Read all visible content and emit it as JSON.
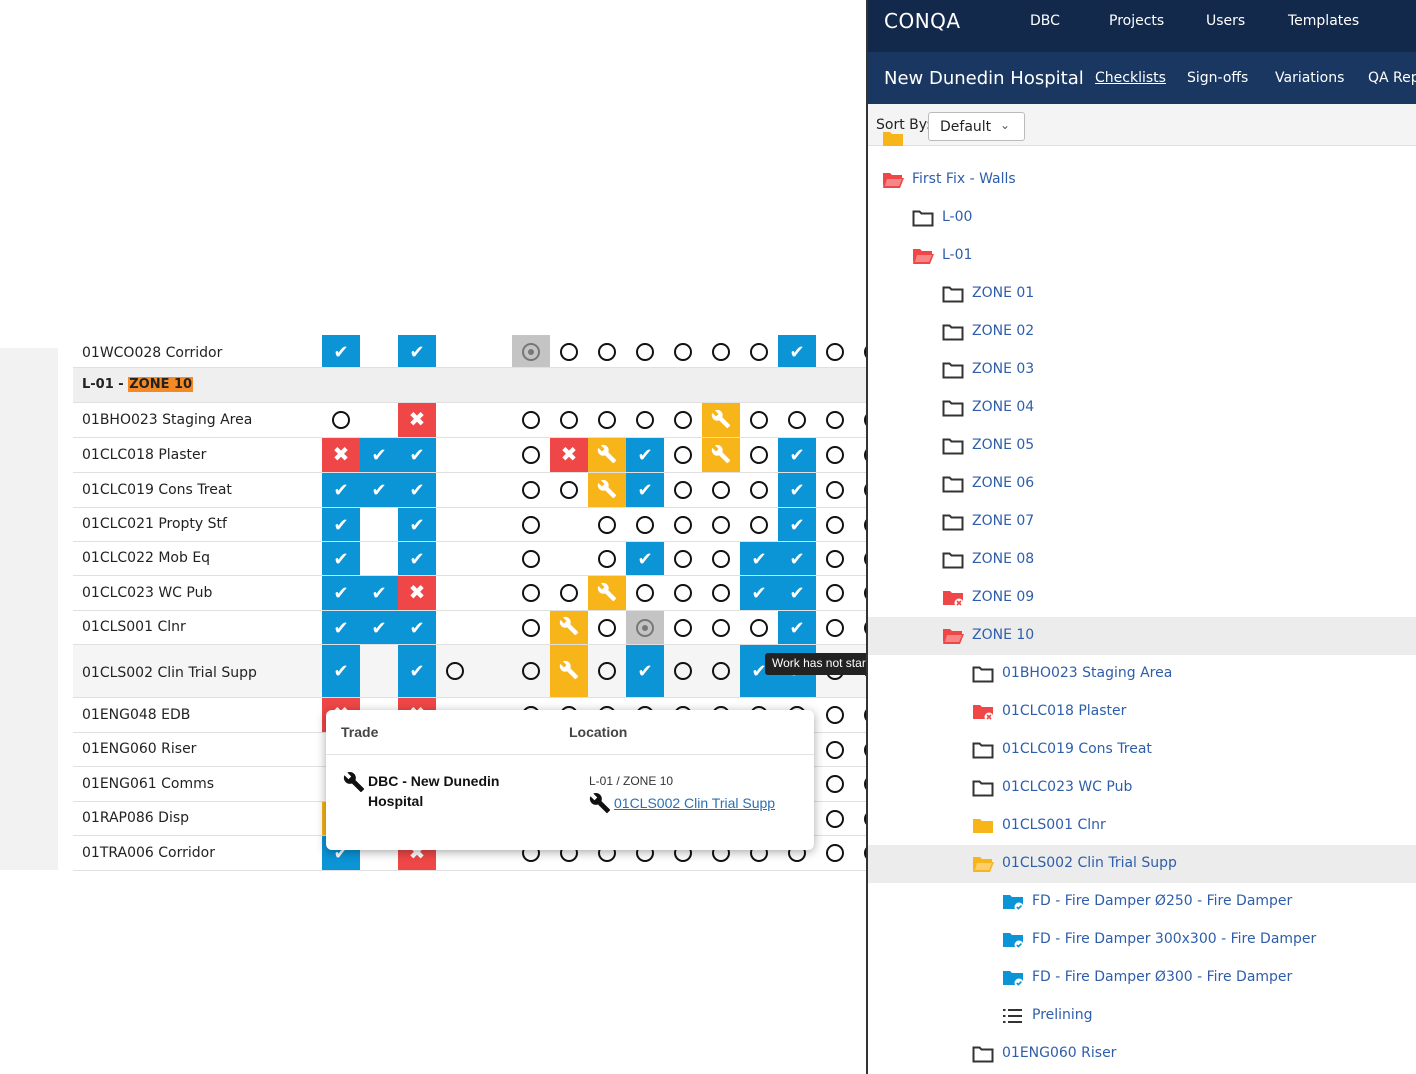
{
  "topbar": {
    "logo": "CONQA",
    "nav": [
      "DBC",
      "Projects",
      "Users",
      "Templates"
    ]
  },
  "subbar": {
    "project_title": "New Dunedin Hospital",
    "tabs": [
      "Checklists",
      "Sign-offs",
      "Variations",
      "QA Repo"
    ],
    "active_tab": "Checklists"
  },
  "sort": {
    "label": "Sort By:",
    "value": "Default"
  },
  "tree": [
    {
      "label": "First Fix - Walls",
      "indent": 0,
      "icon": "folder-open-red"
    },
    {
      "label": "L-00",
      "indent": 1,
      "icon": "folder-outline"
    },
    {
      "label": "L-01",
      "indent": 1,
      "icon": "folder-open-red"
    },
    {
      "label": "ZONE 01",
      "indent": 2,
      "icon": "folder-outline"
    },
    {
      "label": "ZONE 02",
      "indent": 2,
      "icon": "folder-outline"
    },
    {
      "label": "ZONE 03",
      "indent": 2,
      "icon": "folder-outline"
    },
    {
      "label": "ZONE 04",
      "indent": 2,
      "icon": "folder-outline"
    },
    {
      "label": "ZONE 05",
      "indent": 2,
      "icon": "folder-outline"
    },
    {
      "label": "ZONE 06",
      "indent": 2,
      "icon": "folder-outline"
    },
    {
      "label": "ZONE 07",
      "indent": 2,
      "icon": "folder-outline"
    },
    {
      "label": "ZONE 08",
      "indent": 2,
      "icon": "folder-outline"
    },
    {
      "label": "ZONE 09",
      "indent": 2,
      "icon": "folder-red-x"
    },
    {
      "label": "ZONE 10",
      "indent": 2,
      "icon": "folder-open-red",
      "selected": true
    },
    {
      "label": "01BHO023 Staging Area",
      "indent": 3,
      "icon": "folder-outline"
    },
    {
      "label": "01CLC018 Plaster",
      "indent": 3,
      "icon": "folder-red-x"
    },
    {
      "label": "01CLC019 Cons Treat",
      "indent": 3,
      "icon": "folder-outline"
    },
    {
      "label": "01CLC023 WC Pub",
      "indent": 3,
      "icon": "folder-outline"
    },
    {
      "label": "01CLS001 Clnr",
      "indent": 3,
      "icon": "folder-yellow"
    },
    {
      "label": "01CLS002 Clin Trial Supp",
      "indent": 3,
      "icon": "folder-open-yellow",
      "selected": true
    },
    {
      "label": "FD - Fire Damper Ø250 - Fire Damper",
      "indent": 4,
      "icon": "folder-blue-check"
    },
    {
      "label": "FD - Fire Damper 300x300 - Fire Damper",
      "indent": 4,
      "icon": "folder-blue-check"
    },
    {
      "label": "FD - Fire Damper Ø300 - Fire Damper",
      "indent": 4,
      "icon": "folder-blue-check"
    },
    {
      "label": "Prelining",
      "indent": 4,
      "icon": "list-icon"
    },
    {
      "label": "01ENG060 Riser",
      "indent": 3,
      "icon": "folder-outline"
    }
  ],
  "grid": {
    "zone_header": {
      "level": "L-01 - ",
      "zone": "ZONE 10"
    },
    "rows": [
      {
        "name": "01WCO028 Corridor",
        "cells": [
          "B",
          "",
          "B",
          "",
          "",
          "T",
          "O",
          "O",
          "O",
          "O",
          "O",
          "O",
          "B",
          "O",
          "O"
        ]
      },
      {
        "name": "01BHO023 Staging Area",
        "cells": [
          "O",
          "",
          "X",
          "",
          "",
          "O",
          "O",
          "O",
          "O",
          "O",
          "W",
          "O",
          "O",
          "O",
          "O"
        ]
      },
      {
        "name": "01CLC018 Plaster",
        "cells": [
          "X",
          "B",
          "B",
          "",
          "",
          "O",
          "X",
          "W",
          "B",
          "O",
          "W",
          "O",
          "B",
          "O",
          "O"
        ]
      },
      {
        "name": "01CLC019 Cons Treat",
        "cells": [
          "B",
          "B",
          "B",
          "",
          "",
          "O",
          "O",
          "W",
          "B",
          "O",
          "O",
          "O",
          "B",
          "O",
          "O"
        ]
      },
      {
        "name": "01CLC021 Propty Stf",
        "cells": [
          "B",
          "",
          "B",
          "",
          "",
          "O",
          "",
          "O",
          "O",
          "O",
          "O",
          "O",
          "B",
          "O",
          "O"
        ]
      },
      {
        "name": "01CLC022 Mob Eq",
        "cells": [
          "B",
          "",
          "B",
          "",
          "",
          "O",
          "",
          "O",
          "B",
          "O",
          "O",
          "B",
          "B",
          "O",
          "O"
        ]
      },
      {
        "name": "01CLC023 WC Pub",
        "cells": [
          "B",
          "B",
          "X",
          "",
          "",
          "O",
          "O",
          "W",
          "O",
          "O",
          "O",
          "B",
          "B",
          "O",
          "O"
        ]
      },
      {
        "name": "01CLS001 Clnr",
        "cells": [
          "B",
          "B",
          "B",
          "",
          "",
          "O",
          "W",
          "O",
          "T",
          "O",
          "O",
          "O",
          "B",
          "O",
          "O"
        ]
      },
      {
        "name": "01CLS002 Clin Trial Supp",
        "cells": [
          "B",
          "",
          "B",
          "O",
          "",
          "O",
          "W",
          "O",
          "B",
          "O",
          "O",
          "B",
          "B",
          "O",
          "O"
        ]
      },
      {
        "name": "01ENG048 EDB",
        "cells": [
          "X",
          "",
          "X",
          "",
          "",
          "O",
          "O",
          "O",
          "O",
          "O",
          "O",
          "O",
          "O",
          "O",
          "O"
        ]
      },
      {
        "name": "01ENG060 Riser",
        "cells": [
          "",
          "",
          "",
          "",
          "",
          "",
          "",
          "",
          "",
          "",
          "",
          "",
          "",
          "O",
          "O"
        ]
      },
      {
        "name": "01ENG061 Comms",
        "cells": [
          "",
          "",
          "",
          "",
          "",
          "",
          "",
          "",
          "",
          "",
          "",
          "",
          "",
          "O",
          "O"
        ]
      },
      {
        "name": "01RAP086 Disp",
        "cells": [
          "W",
          "",
          "",
          "",
          "",
          "",
          "",
          "",
          "",
          "",
          "",
          "",
          "",
          "O",
          "O"
        ]
      },
      {
        "name": "01TRA006 Corridor",
        "cells": [
          "B",
          "",
          "X",
          "",
          "",
          "O",
          "O",
          "O",
          "O",
          "O",
          "O",
          "O",
          "O",
          "O",
          "O"
        ]
      }
    ]
  },
  "popup": {
    "col_trade": "Trade",
    "col_location": "Location",
    "trade_line1": "DBC - New Dunedin",
    "trade_line2": "Hospital",
    "location_path": "L-01 / ZONE 10",
    "location_link": "01CLS002 Clin Trial Supp"
  },
  "tooltip": {
    "text": "Work has not star"
  },
  "colors": {
    "blue": "#0b94d6",
    "red": "#ef4747",
    "amber": "#f8b51a",
    "navy": "#13294b",
    "link": "#2e5eaa"
  }
}
